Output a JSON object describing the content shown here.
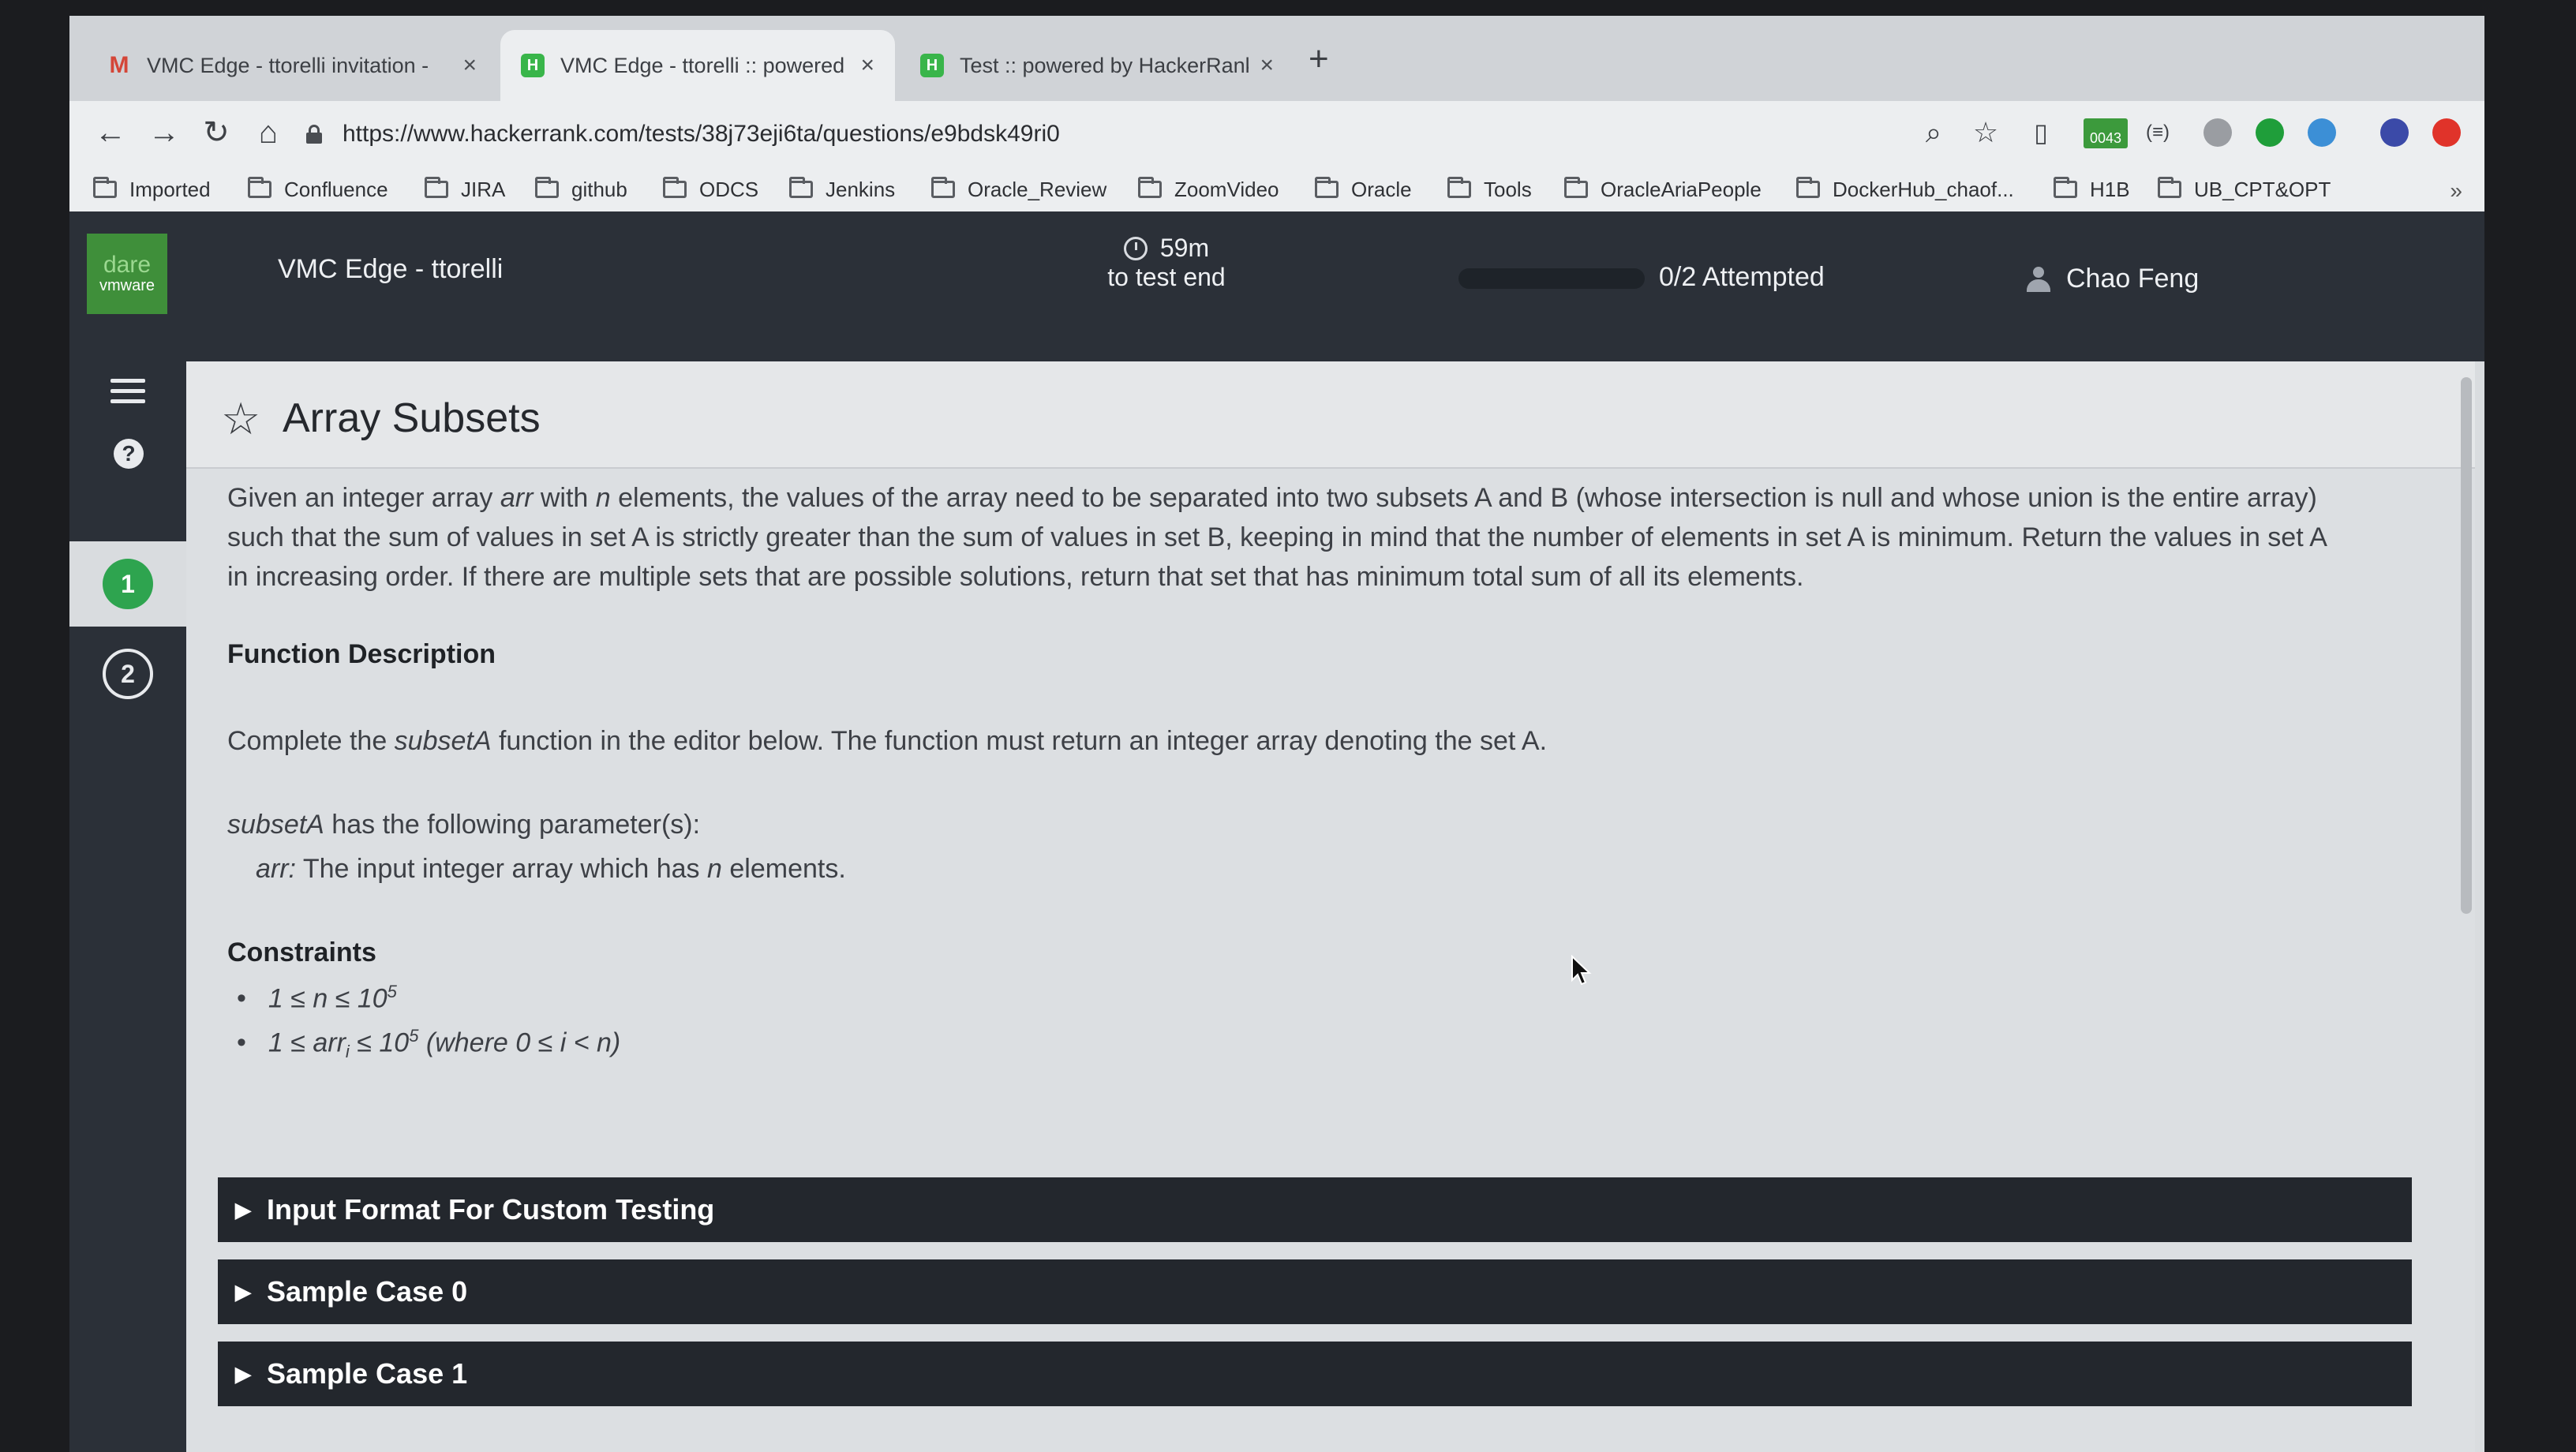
{
  "browser": {
    "tabs": [
      {
        "title": "VMC Edge - ttorelli invitation -",
        "favicon": "gmail-icon",
        "active": false
      },
      {
        "title": "VMC Edge - ttorelli :: powered",
        "favicon": "hackerrank-icon",
        "active": true
      },
      {
        "title": "Test :: powered by HackerRank",
        "favicon": "hackerrank-icon",
        "active": false
      }
    ],
    "new_tab_label": "+",
    "url": "https://www.hackerrank.com/tests/38j73eji6ta/questions/e9bdsk49ri0",
    "ext_badge": "0043",
    "bookmarks": [
      "Imported",
      "Confluence",
      "JIRA",
      "github",
      "ODCS",
      "Jenkins",
      "Oracle_Review",
      "ZoomVideo",
      "Oracle",
      "Tools",
      "OracleAriaPeople",
      "DockerHub_chaof...",
      "H1B",
      "UB_CPT&OPT"
    ],
    "bookmarks_more": "»"
  },
  "header": {
    "logo_line1": "dare",
    "logo_line2": "vmware",
    "test_name": "VMC Edge - ttorelli",
    "timer_value": "59m",
    "timer_label": "to test end",
    "attempted": "0/2 Attempted",
    "attempted_fraction": 0.0,
    "user_name": "Chao Feng"
  },
  "sidebar": {
    "questions": [
      {
        "number": "1",
        "state": "current"
      },
      {
        "number": "2",
        "state": "not-attempted"
      }
    ]
  },
  "question": {
    "title": "Array Subsets",
    "description": {
      "p1": "Given an integer array ",
      "arr": "arr",
      "p2": " with ",
      "n": "n",
      "p3": " elements, the values of the array need to be separated into two subsets A and B (whose intersection is null and whose union is the entire array) such that the sum of values in set A is strictly greater than the sum of values in set B, keeping in mind that the number of elements in set A is minimum. Return the values in set A in increasing order. If there are multiple sets that are possible solutions, return that set that has minimum total sum of all its elements."
    },
    "function_description_heading": "Function Description",
    "function_description": {
      "p1": "Complete the ",
      "fn": "subsetA",
      "p2": " function in the editor below. The function must return an integer array denoting the set A."
    },
    "params": {
      "fn": "subsetA",
      "intro": " has the following parameter(s):",
      "name": "arr:",
      "text": " The input integer array which has ",
      "n": "n",
      "tail": " elements."
    },
    "constraints_heading": "Constraints",
    "constraints": [
      {
        "pre": "1 ≤ n ≤ 10",
        "sup": "5",
        "post": ""
      },
      {
        "pre": "1 ≤ arr",
        "sub": "i",
        "mid": " ≤ 10",
        "sup": "5",
        "post": " (where 0 ≤ i < n)"
      }
    ],
    "sections": [
      "Input Format For Custom Testing",
      "Sample Case 0",
      "Sample Case 1"
    ]
  }
}
